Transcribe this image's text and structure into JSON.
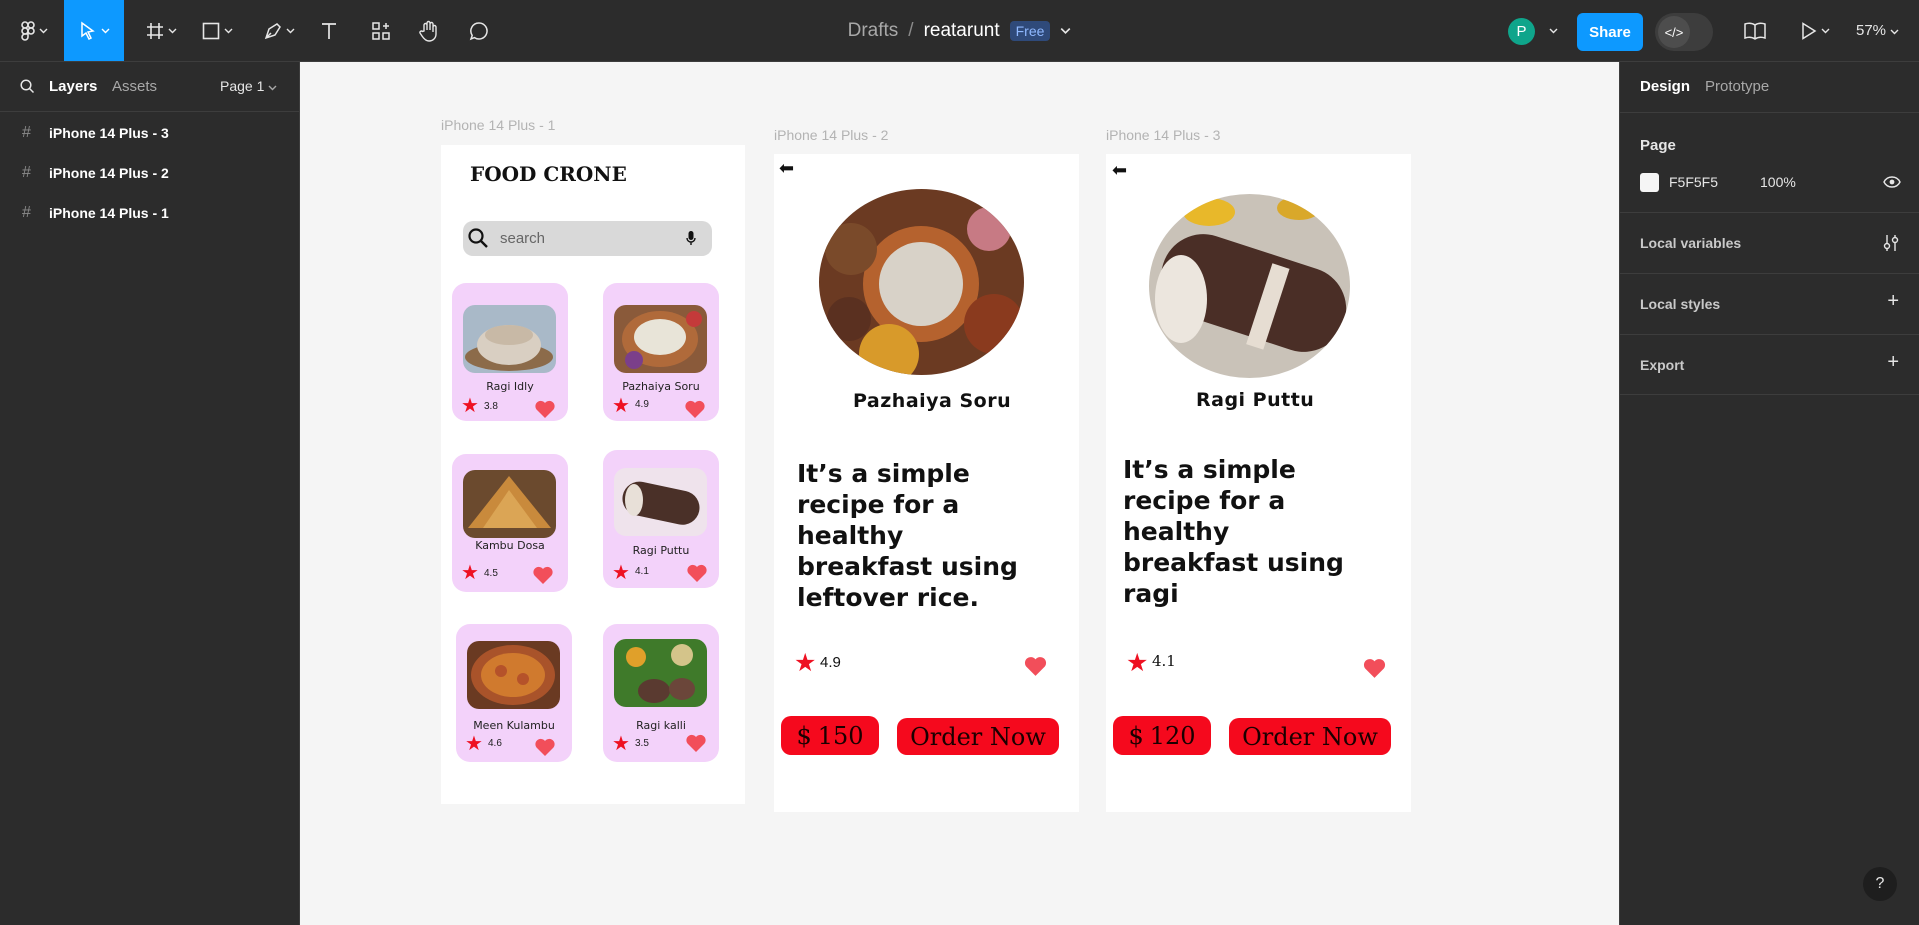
{
  "toolbar": {
    "breadcrumb_drafts": "Drafts",
    "breadcrumb_separator": "/",
    "file_name": "reatarunt",
    "plan_badge": "Free",
    "avatar_initial": "P",
    "share_label": "Share",
    "zoom_level": "57%",
    "dev_mode_icon": "</>"
  },
  "left_panel": {
    "tab_layers": "Layers",
    "tab_assets": "Assets",
    "page_selector": "Page 1",
    "layers": [
      {
        "name": "iPhone 14 Plus - 3"
      },
      {
        "name": "iPhone 14 Plus - 2"
      },
      {
        "name": "iPhone 14 Plus - 1"
      }
    ]
  },
  "right_panel": {
    "tab_design": "Design",
    "tab_prototype": "Prototype",
    "page_section_label": "Page",
    "page_color_hex": "F5F5F5",
    "page_opacity": "100%",
    "local_variables": "Local variables",
    "local_styles": "Local styles",
    "export": "Export"
  },
  "canvas": {
    "frame1": {
      "title": "iPhone 14 Plus - 1",
      "app_title": "FOOD CRONE",
      "search_placeholder": "search",
      "cards": [
        {
          "name": "Ragi Idly",
          "rating": "3.8"
        },
        {
          "name": "Pazhaiya Soru",
          "rating": "4.9"
        },
        {
          "name": "Kambu Dosa",
          "rating": "4.5"
        },
        {
          "name": "Ragi Puttu",
          "rating": "4.1"
        },
        {
          "name": "Meen Kulambu",
          "rating": "4.6"
        },
        {
          "name": "Ragi kalli",
          "rating": "3.5"
        }
      ]
    },
    "frame2": {
      "title": "iPhone 14 Plus - 2",
      "dish_name": "Pazhaiya Soru",
      "description": "It’s a simple recipe for a healthy breakfast using leftover rice.",
      "rating": "4.9",
      "currency": "$",
      "price": "150",
      "order_label": "Order Now"
    },
    "frame3": {
      "title": "iPhone 14 Plus - 3",
      "dish_name": "Ragi Puttu",
      "description": "It’s a simple recipe for a healthy breakfast using ragi",
      "rating": "4.1",
      "currency": "$",
      "price": "120",
      "order_label": "Order Now"
    }
  },
  "colors": {
    "accent": "#0d99ff",
    "card_bg": "#f3d2fa",
    "button_red": "#f5091d",
    "canvas_bg": "#f5f5f5"
  },
  "help_label": "?"
}
